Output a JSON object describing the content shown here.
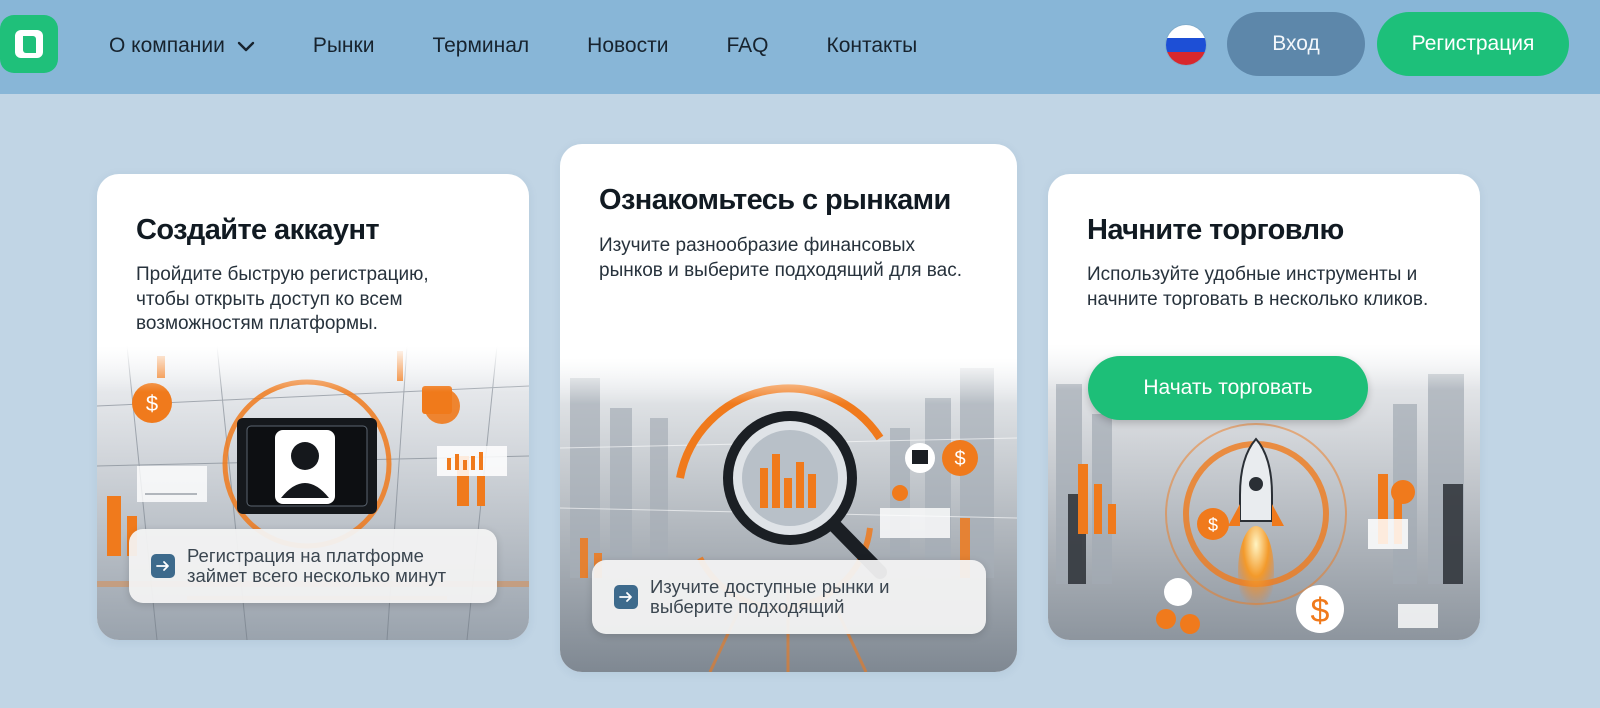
{
  "header": {
    "logo": "brand-logo",
    "nav": [
      {
        "label": "О компании",
        "has_dropdown": true
      },
      {
        "label": "Рынки"
      },
      {
        "label": "Терминал"
      },
      {
        "label": "Новости"
      },
      {
        "label": "FAQ"
      },
      {
        "label": "Контакты"
      }
    ],
    "language_flag": "russian-flag",
    "login_label": "Вход",
    "register_label": "Регистрация"
  },
  "cards": [
    {
      "title": "Создайте аккаунт",
      "text": "Пройдите быструю регистрацию, чтобы открыть доступ ко всем возможностям платформы.",
      "pill_text": "Регистрация на платформе займет всего несколько минут"
    },
    {
      "title": "Ознакомьтесь с рынками",
      "text": "Изучите разнообразие финансовых рынков и выберите подходящий для вас.",
      "pill_text": "Изучите доступные рынки и выберите подходящий"
    },
    {
      "title": "Начните торговлю",
      "text": "Используйте удобные инструменты и начните торговать в несколько кликов.",
      "button_label": "Начать торговать"
    }
  ],
  "colors": {
    "page_background": "#c1d5e5",
    "header_background": "#88b6d7",
    "accent_green": "#1dc07a",
    "login_button": "#5d87aa",
    "art_orange": "#f07a1c"
  }
}
